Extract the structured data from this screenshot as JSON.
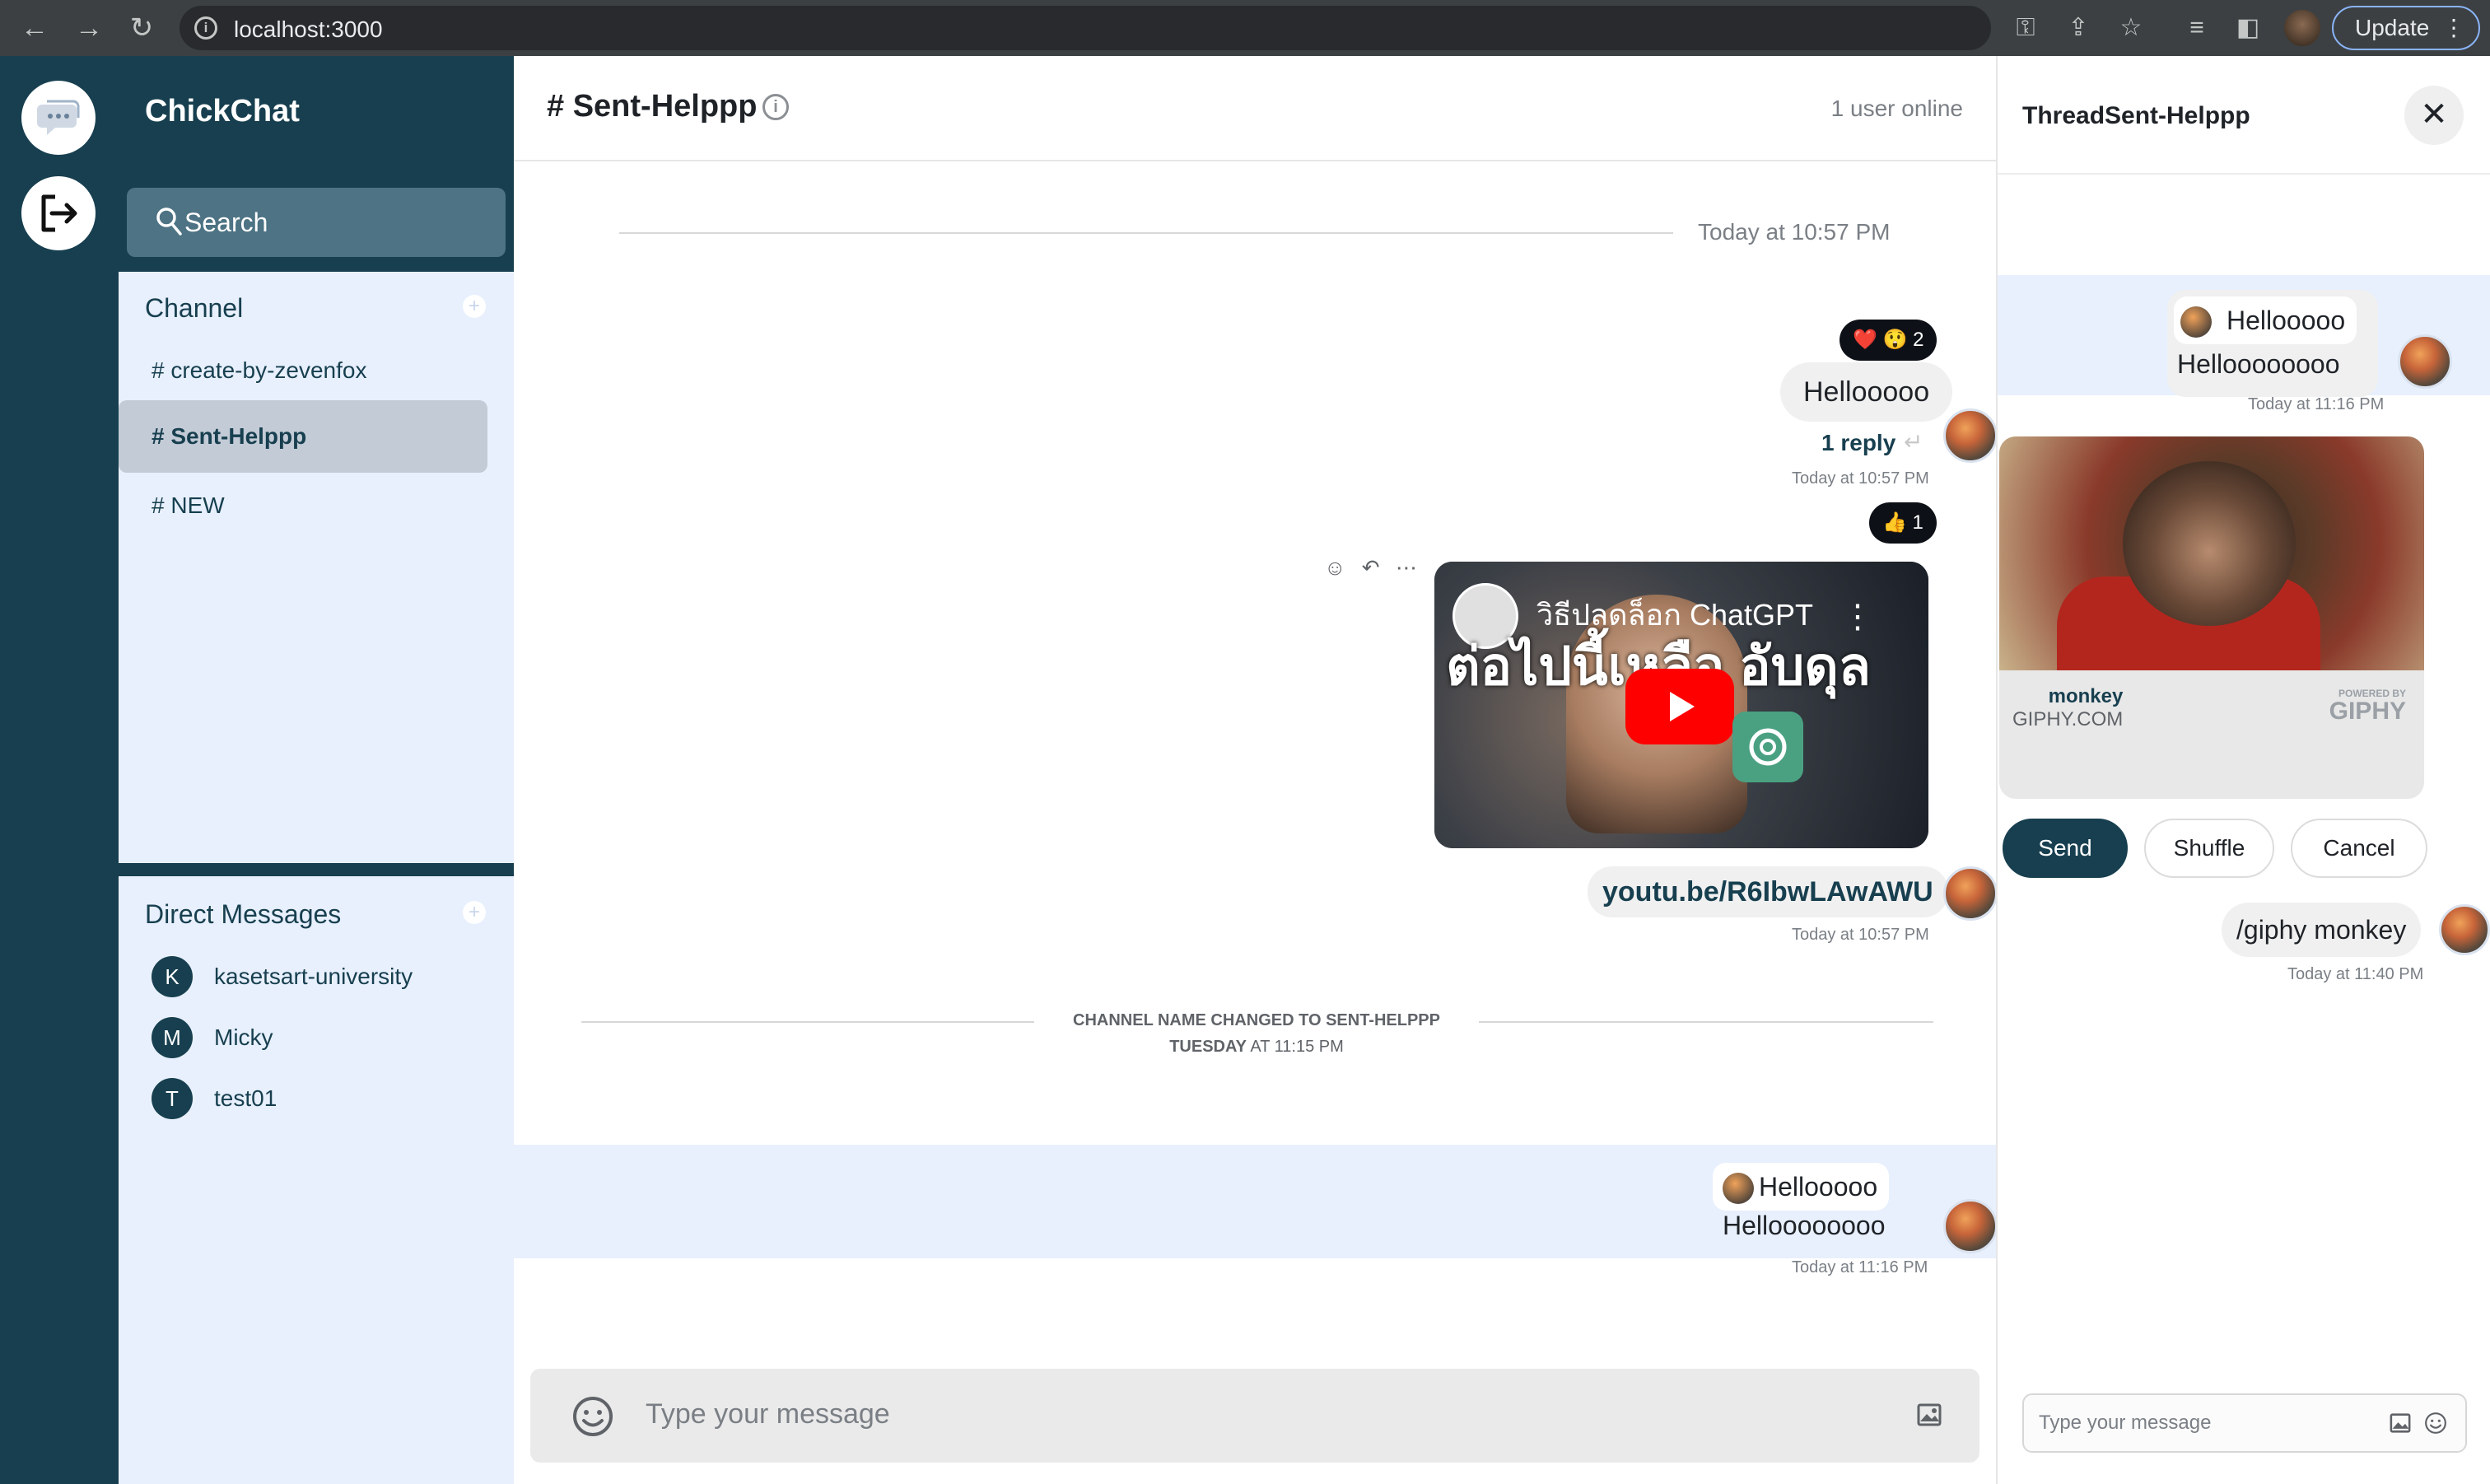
{
  "browser": {
    "url": "localhost:3000",
    "update_label": "Update"
  },
  "app": {
    "name": "ChickChat",
    "search_label": "Search"
  },
  "channels": {
    "title": "Channel",
    "items": [
      {
        "label": "# create-by-zevenfox"
      },
      {
        "label": "# Sent-Helppp"
      },
      {
        "label": "# NEW"
      }
    ]
  },
  "direct_messages": {
    "title": "Direct Messages",
    "items": [
      {
        "initial": "K",
        "name": "kasetsart-university"
      },
      {
        "initial": "M",
        "name": "Micky"
      },
      {
        "initial": "T",
        "name": "test01"
      }
    ]
  },
  "main": {
    "channel_title": "# Sent-Helppp",
    "online_status": "1 user online",
    "date_separator": "Today at 10:57 PM",
    "messages": {
      "hello": {
        "reactions": "❤️ 😲 2",
        "text": "Hellooooo",
        "reply_count": "1 reply",
        "timestamp": "Today at 10:57 PM"
      },
      "video": {
        "reactions": "👍 1",
        "video_title": "วิธีปลดล็อก ChatGPT",
        "video_overlay": "ต่อไปนี้เหลือ อับดุล",
        "link": "youtu.be/R6IbwLAwAWU",
        "timestamp": "Today at 10:57 PM"
      },
      "system": {
        "line1": "CHANNEL NAME CHANGED TO SENT-HELPPP",
        "day": "TUESDAY",
        "line2": "AT 11:15 PM"
      },
      "quoted": {
        "quote_text": "Hellooooo",
        "text": "Helloooooooo",
        "timestamp": "Today at 11:16 PM"
      }
    },
    "composer_placeholder": "Type your message"
  },
  "thread": {
    "title": "ThreadSent-Helppp",
    "quoted": {
      "quote_text": "Hellooooo",
      "text": "Helloooooooo",
      "timestamp": "Today at 11:16 PM"
    },
    "giphy": {
      "name": "monkey",
      "site": "GIPHY.COM",
      "powered_small": "POWERED BY",
      "powered_brand": "GIPHY"
    },
    "buttons": {
      "send": "Send",
      "shuffle": "Shuffle",
      "cancel": "Cancel"
    },
    "command": {
      "text": "/giphy monkey",
      "timestamp": "Today at 11:40 PM"
    },
    "composer_placeholder": "Type your message"
  },
  "colors": {
    "primary": "#173f4f",
    "sidebar_bg": "#e8f0fd",
    "highlight": "#e8f0fd",
    "youtube_red": "#ff0000"
  }
}
